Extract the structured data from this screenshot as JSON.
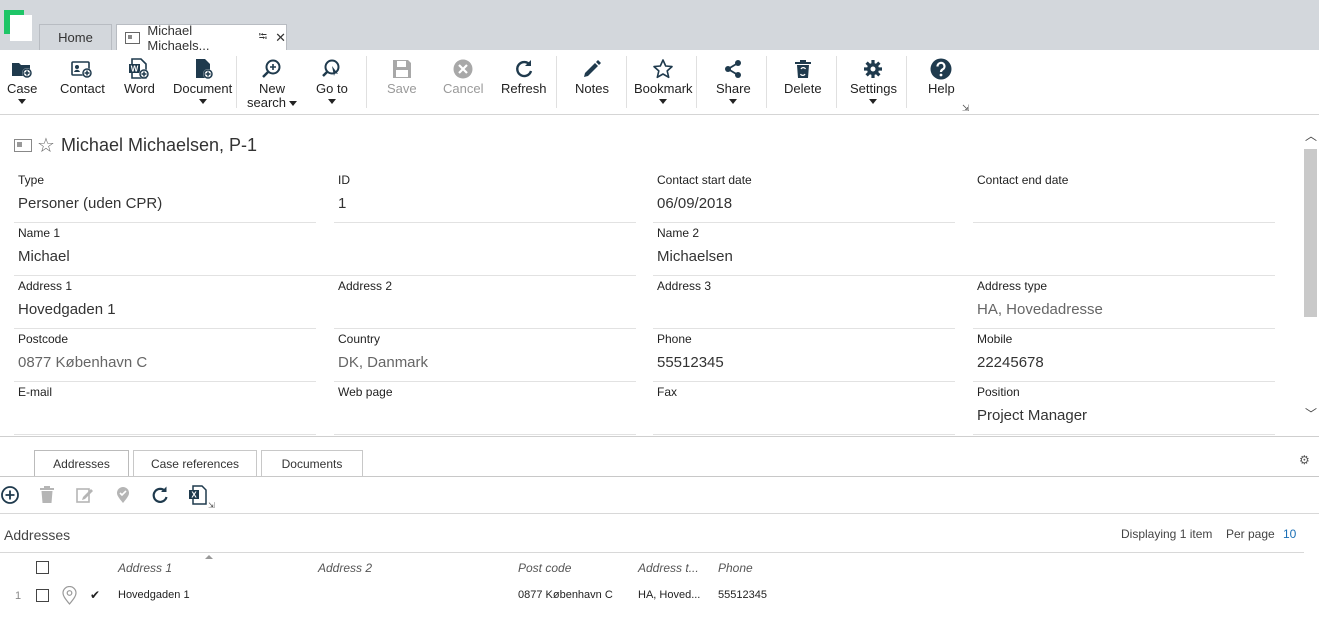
{
  "tabs": {
    "home": "Home",
    "active": "Michael Michaels..."
  },
  "toolbar": {
    "case": "Case",
    "contact": "Contact",
    "word": "Word",
    "document": "Document",
    "new_search_1": "New",
    "new_search_2": "search",
    "goto": "Go to",
    "save": "Save",
    "cancel": "Cancel",
    "refresh": "Refresh",
    "notes": "Notes",
    "bookmark": "Bookmark",
    "share": "Share",
    "delete": "Delete",
    "settings": "Settings",
    "help": "Help"
  },
  "record": {
    "title": "Michael Michaelsen, P-1",
    "fields": {
      "type": {
        "label": "Type",
        "value": "Personer (uden CPR)"
      },
      "id": {
        "label": "ID",
        "value": "1"
      },
      "start": {
        "label": "Contact start date",
        "value": "06/09/2018"
      },
      "end": {
        "label": "Contact end date",
        "value": ""
      },
      "name1": {
        "label": "Name 1",
        "value": "Michael"
      },
      "name2": {
        "label": "Name 2",
        "value": "Michaelsen"
      },
      "addr1": {
        "label": "Address 1",
        "value": "Hovedgaden 1"
      },
      "addr2": {
        "label": "Address 2",
        "value": ""
      },
      "addr3": {
        "label": "Address 3",
        "value": ""
      },
      "addrtype": {
        "label": "Address type",
        "value": "HA, Hovedadresse"
      },
      "postcode": {
        "label": "Postcode",
        "value": "0877 København C"
      },
      "country": {
        "label": "Country",
        "value": "DK, Danmark"
      },
      "phone": {
        "label": "Phone",
        "value": "55512345"
      },
      "mobile": {
        "label": "Mobile",
        "value": "22245678"
      },
      "email": {
        "label": "E-mail",
        "value": ""
      },
      "web": {
        "label": "Web page",
        "value": ""
      },
      "fax": {
        "label": "Fax",
        "value": ""
      },
      "position": {
        "label": "Position",
        "value": "Project Manager"
      }
    }
  },
  "bottom_tabs": {
    "addresses": "Addresses",
    "case_refs": "Case references",
    "documents": "Documents"
  },
  "grid": {
    "heading": "Addresses",
    "displaying": "Displaying 1 item",
    "per_page_label": "Per page",
    "per_page_value": "10",
    "columns": {
      "address1": "Address 1",
      "address2": "Address 2",
      "postcode": "Post code",
      "addrtype": "Address t...",
      "phone": "Phone"
    },
    "rows": [
      {
        "num": "1",
        "address1": "Hovedgaden 1",
        "address2": "",
        "postcode": "0877 København C",
        "addrtype": "HA, Hoved...",
        "phone": "55512345"
      }
    ]
  },
  "colors": {
    "accent": "#1ec567",
    "link": "#1a6fb5",
    "icon": "#1f3a4d"
  }
}
